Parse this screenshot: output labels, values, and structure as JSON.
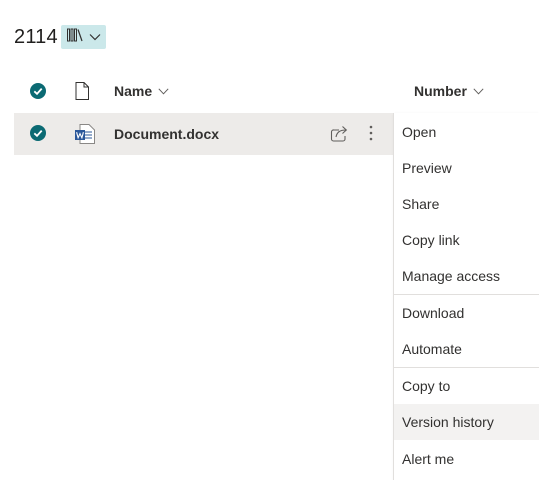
{
  "library": {
    "title": "2114",
    "view_switch_icon": "library-icon"
  },
  "columns": {
    "select_all_icon": "checkmark-circle-icon",
    "file_type_icon": "document-icon",
    "name_label": "Name",
    "number_label": "Number"
  },
  "files": [
    {
      "name": "Document.docx",
      "type_icon": "word-doc-icon",
      "selected": true
    }
  ],
  "context_menu": {
    "items": [
      {
        "label": "Open"
      },
      {
        "label": "Preview"
      },
      {
        "label": "Share"
      },
      {
        "label": "Copy link"
      },
      {
        "label": "Manage access"
      },
      {
        "label": "Download"
      },
      {
        "label": "Automate"
      },
      {
        "label": "Copy to"
      },
      {
        "label": "Version history"
      },
      {
        "label": "Alert me"
      }
    ],
    "hovered_item": "Version history"
  },
  "colors": {
    "accent_teal": "#0b6a73",
    "view_switch_bg": "#cbe8ea",
    "selected_row_bg": "#edebe9",
    "word_blue": "#2b579a"
  }
}
